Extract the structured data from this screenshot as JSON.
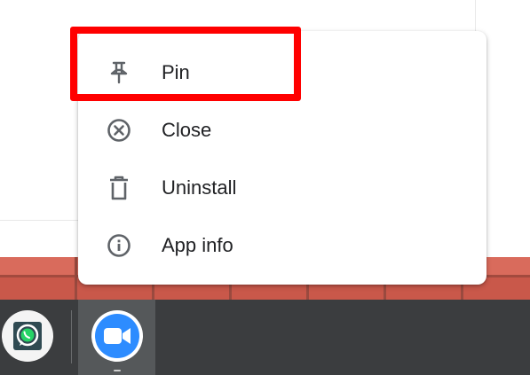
{
  "context_menu": {
    "items": [
      {
        "label": "Pin",
        "icon": "pin-icon"
      },
      {
        "label": "Close",
        "icon": "close-circle-icon"
      },
      {
        "label": "Uninstall",
        "icon": "trash-icon"
      },
      {
        "label": "App info",
        "icon": "info-icon"
      }
    ],
    "highlighted_item": "Pin",
    "highlight_color": "#ff0000"
  },
  "shelf": {
    "apps": [
      {
        "name": "WhatsApp",
        "icon": "whatsapp-icon",
        "brand_color": "#25d366"
      },
      {
        "name": "Zoom",
        "icon": "zoom-video-icon",
        "brand_color": "#2d8cff",
        "running": true
      }
    ]
  }
}
